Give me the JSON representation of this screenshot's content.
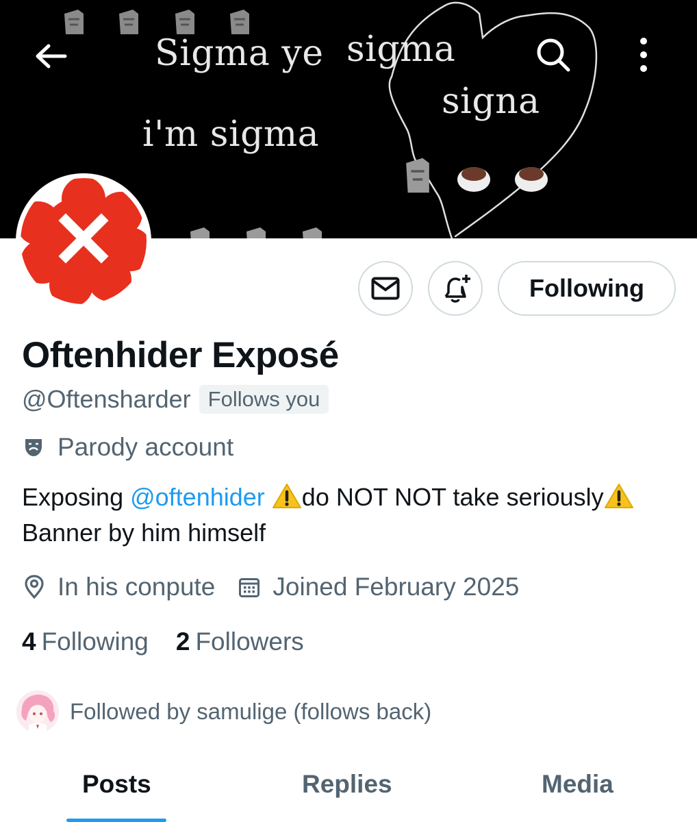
{
  "banner": {
    "texts": [
      "Sigma ye",
      "sigma",
      "signa",
      "i'm sigma"
    ]
  },
  "nav": {
    "back_icon": "back-arrow-icon",
    "search_icon": "search-icon",
    "more_icon": "more-vertical-icon"
  },
  "actions": {
    "message_icon": "mail-icon",
    "notify_icon": "bell-plus-icon",
    "follow_label": "Following"
  },
  "profile": {
    "display_name": "Oftenhider Exposé",
    "handle": "@Oftensharder",
    "follows_you": "Follows you",
    "parody_label": "Parody account",
    "bio": {
      "prefix": "Exposing ",
      "mention": "@oftenhider",
      "part2": "do NOT NOT take seriously",
      "part3": " Banner by him himself"
    },
    "location": "In his conpute",
    "joined": "Joined February 2025",
    "following_count": "4",
    "following_label": "Following",
    "followers_count": "2",
    "followers_label": "Followers",
    "followed_by": "Followed by samulige (follows back)"
  },
  "tabs": [
    {
      "label": "Posts",
      "active": true
    },
    {
      "label": "Replies",
      "active": false
    },
    {
      "label": "Media",
      "active": false
    }
  ],
  "colors": {
    "accent": "#1d9bf0",
    "secondary_text": "#536471",
    "avatar_red": "#e8301e"
  }
}
